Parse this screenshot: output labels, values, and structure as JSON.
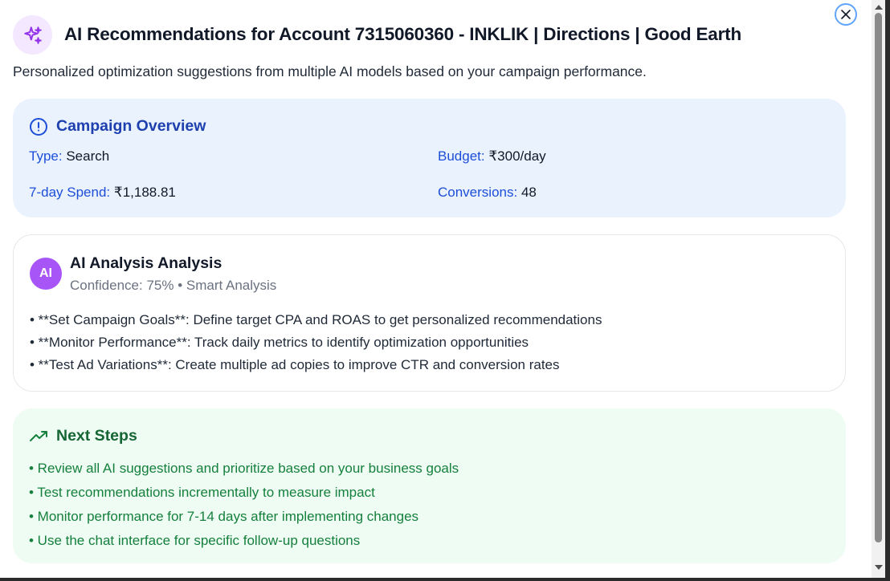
{
  "header": {
    "icon": "sparkles-icon",
    "title": "AI Recommendations for Account 7315060360 - INKLIK | Directions | Good Earth",
    "subtitle": "Personalized optimization suggestions from multiple AI models based on your campaign performance.",
    "close_icon": "close-icon"
  },
  "overview": {
    "icon": "info-circle-icon",
    "title": "Campaign Overview",
    "items": [
      {
        "label": "Type:",
        "value": "Search"
      },
      {
        "label": "Budget:",
        "value": "₹300/day"
      },
      {
        "label": "7-day Spend:",
        "value": "₹1,188.81"
      },
      {
        "label": "Conversions:",
        "value": "48"
      }
    ]
  },
  "analysis": {
    "avatar": "AI",
    "title": "AI Analysis Analysis",
    "meta": "Confidence: 75% • Smart Analysis",
    "items": [
      "• **Set Campaign Goals**: Define target CPA and ROAS to get personalized recommendations",
      "• **Monitor Performance**: Track daily metrics to identify optimization opportunities",
      "• **Test Ad Variations**: Create multiple ad copies to improve CTR and conversion rates"
    ]
  },
  "next_steps": {
    "icon": "trending-up-icon",
    "title": "Next Steps",
    "items": [
      "• Review all AI suggestions and prioritize based on your business goals",
      "• Test recommendations incrementally to measure impact",
      "• Monitor performance for 7-14 days after implementing changes",
      "• Use the chat interface for specific follow-up questions"
    ]
  },
  "colors": {
    "accent_purple": "#a855f7",
    "overview_bg": "#eaf2fe",
    "overview_text": "#1e40af",
    "next_bg": "#effcf3",
    "next_text": "#15803d"
  }
}
